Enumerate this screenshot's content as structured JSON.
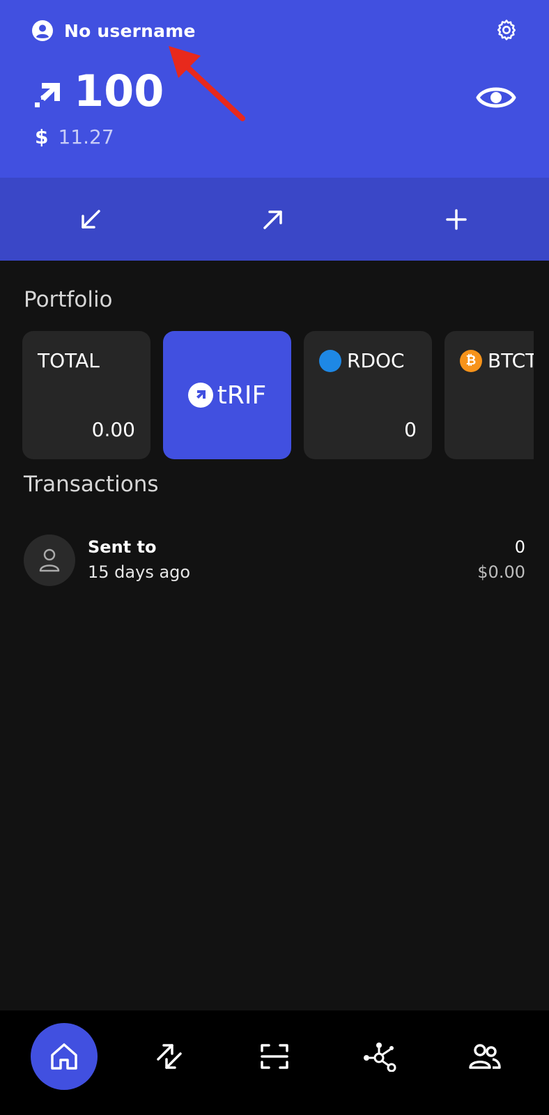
{
  "header": {
    "username": "No username",
    "balance": "100",
    "fiat_symbol": "$",
    "fiat_value": "11.27"
  },
  "icons": {
    "user": "user-circle-icon",
    "settings": "gear-icon",
    "token": "rif-logo-icon",
    "visibility": "eye-icon",
    "receive": "arrow-down-left-icon",
    "send": "arrow-up-right-icon",
    "add": "plus-icon",
    "home": "home-icon",
    "exchange": "swap-icon",
    "scan": "scan-icon",
    "dapps": "network-icon",
    "contacts": "contacts-icon"
  },
  "portfolio": {
    "title": "Portfolio",
    "cards": [
      {
        "label": "TOTAL",
        "value": "0.00"
      },
      {
        "label": "tRIF",
        "value": ""
      },
      {
        "label": "RDOC",
        "value": "0"
      },
      {
        "label": "BTCT",
        "value": ""
      }
    ]
  },
  "transactions": {
    "title": "Transactions",
    "items": [
      {
        "title": "Sent to",
        "time": "15 days ago",
        "amount": "0",
        "fiat": "$0.00"
      }
    ]
  },
  "colors": {
    "primary": "#4150e0",
    "action_bar": "#3a47c7",
    "background": "#121212",
    "card": "#262626",
    "annotation": "#e8291c"
  }
}
